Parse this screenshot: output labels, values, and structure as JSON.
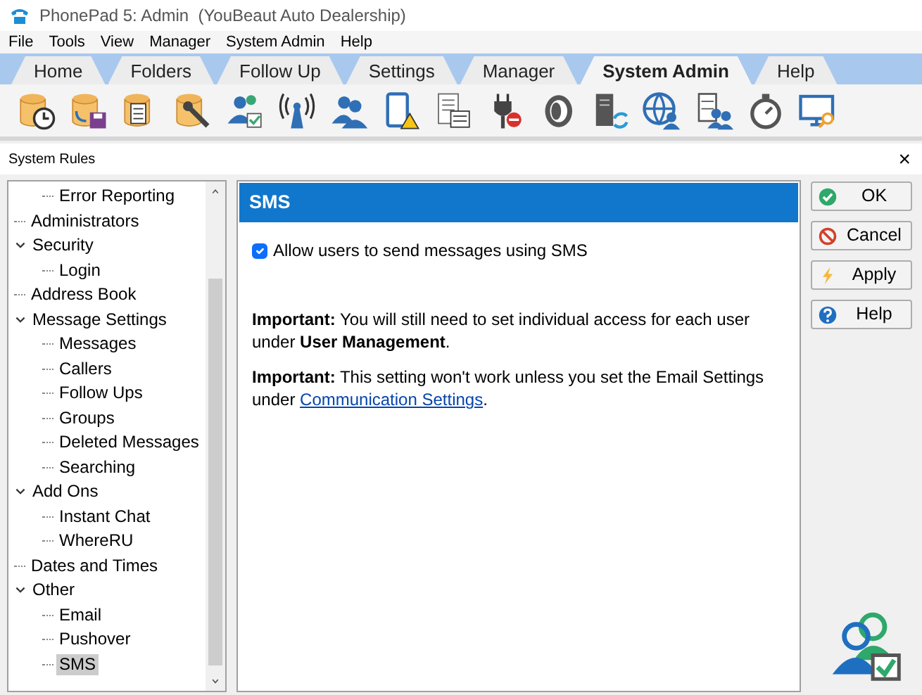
{
  "window": {
    "title": "PhonePad 5: Admin  (YouBeaut Auto Dealership)"
  },
  "menu": [
    "File",
    "Tools",
    "View",
    "Manager",
    "System Admin",
    "Help"
  ],
  "tabs": [
    {
      "label": "Home",
      "selected": false
    },
    {
      "label": "Folders",
      "selected": false
    },
    {
      "label": "Follow Up",
      "selected": false
    },
    {
      "label": "Settings",
      "selected": false
    },
    {
      "label": "Manager",
      "selected": false
    },
    {
      "label": "System Admin",
      "selected": true
    },
    {
      "label": "Help",
      "selected": false
    }
  ],
  "dialog": {
    "title": "System Rules",
    "close": "×"
  },
  "tree": [
    {
      "children": [
        {
          "label": "Error Reporting",
          "selected": false
        }
      ]
    },
    {
      "label": "Administrators",
      "selected": false
    },
    {
      "label": "Security",
      "selected": false,
      "expanded": true,
      "children": [
        {
          "label": "Login",
          "selected": false
        }
      ]
    },
    {
      "label": "Address Book",
      "selected": false
    },
    {
      "label": "Message Settings",
      "selected": false,
      "expanded": true,
      "children": [
        {
          "label": "Messages",
          "selected": false
        },
        {
          "label": "Callers",
          "selected": false
        },
        {
          "label": "Follow Ups",
          "selected": false
        },
        {
          "label": "Groups",
          "selected": false
        },
        {
          "label": "Deleted Messages",
          "selected": false
        },
        {
          "label": "Searching",
          "selected": false
        }
      ]
    },
    {
      "label": "Add Ons",
      "selected": false,
      "expanded": true,
      "children": [
        {
          "label": "Instant Chat",
          "selected": false
        },
        {
          "label": "WhereRU",
          "selected": false
        }
      ]
    },
    {
      "label": "Dates and Times",
      "selected": false
    },
    {
      "label": "Other",
      "selected": false,
      "expanded": true,
      "children": [
        {
          "label": "Email",
          "selected": false
        },
        {
          "label": "Pushover",
          "selected": false
        },
        {
          "label": "SMS",
          "selected": true
        }
      ]
    }
  ],
  "panel": {
    "heading": "SMS",
    "checkbox": {
      "label": "Allow users to send messages using SMS",
      "checked": true
    },
    "note1": "**Important:**  You will still need to set individual access for each user under **User Management**.",
    "note2": {
      "text": "**Important:** This setting won't work unless you set the Email Settings under ",
      "link": "Communication Settings",
      "after": "."
    }
  },
  "buttons": [
    {
      "label": "OK",
      "kind": "ok"
    },
    {
      "label": "Cancel",
      "kind": "cancel"
    },
    {
      "label": "Apply",
      "kind": "apply"
    },
    {
      "label": "Help",
      "kind": "help"
    }
  ]
}
